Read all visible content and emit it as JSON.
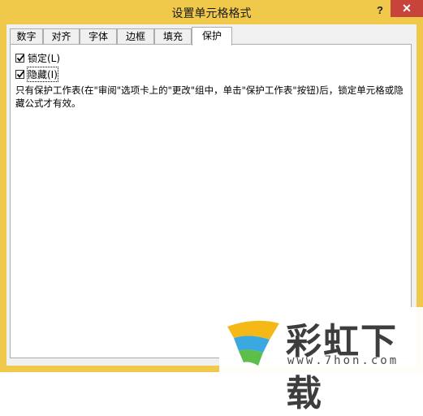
{
  "window": {
    "title": "设置单元格格式",
    "help_label": "?",
    "close_label": "✕"
  },
  "tabs": [
    {
      "label": "数字",
      "active": false
    },
    {
      "label": "对齐",
      "active": false
    },
    {
      "label": "字体",
      "active": false
    },
    {
      "label": "边框",
      "active": false
    },
    {
      "label": "填充",
      "active": false
    },
    {
      "label": "保护",
      "active": true
    }
  ],
  "protection": {
    "locked": {
      "label": "锁定(L)",
      "checked": true
    },
    "hidden": {
      "label": "隐藏(I)",
      "checked": true
    },
    "description": "只有保护工作表(在\"审阅\"选项卡上的\"更改\"组中，单击\"保护工作表\"按钮)后，锁定单元格或隐藏公式才有效。"
  },
  "watermark": {
    "text": "彩虹下载",
    "url": "www.7hon.com"
  }
}
